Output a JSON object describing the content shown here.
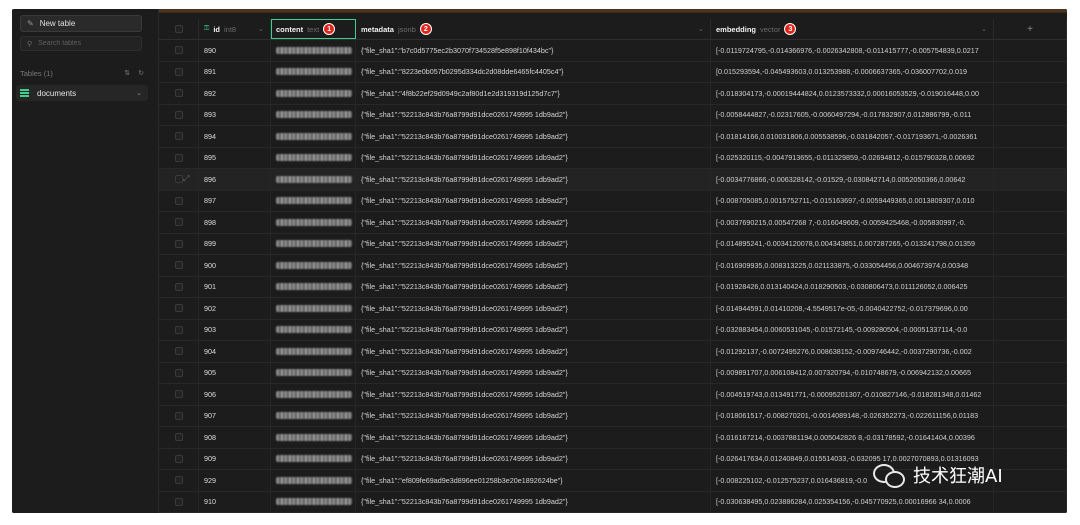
{
  "sidebar": {
    "new_table_label": "New table",
    "search_placeholder": "Search tables",
    "tables_heading": "Tables (1)",
    "tables": [
      {
        "name": "documents"
      }
    ]
  },
  "columns": {
    "id": {
      "name": "id",
      "type": "int8"
    },
    "content": {
      "name": "content",
      "type": "text",
      "badge": "1"
    },
    "metadata": {
      "name": "metadata",
      "type": "jsonb",
      "badge": "2"
    },
    "embedding": {
      "name": "embedding",
      "type": "vector",
      "badge": "3"
    }
  },
  "rows": [
    {
      "id": "890",
      "metadata": "{\"file_sha1\":\"b7c0d5775ec2b3070f734528f5e898f10f434bc\"}",
      "embedding": "[-0.0119724795,-0.014366976,-0.0026342808,-0.011415777,-0.005754839,0.0217"
    },
    {
      "id": "891",
      "metadata": "{\"file_sha1\":\"8223e0b057b0295d334dc2d08dde6465fc4405c4\"}",
      "embedding": "[0.015293594,-0.045493603,0.013253988,-0.0006637365,-0.036007702,0.019"
    },
    {
      "id": "892",
      "metadata": "{\"file_sha1\":\"4f8b22ef29d0949c2af80d1e2d319319d125d7c7\"}",
      "embedding": "[-0.018304173,-0.00019444824,0.0123573332,0.00016053529,-0.019016448,0.00"
    },
    {
      "id": "893",
      "metadata": "{\"file_sha1\":\"52213c843b76a8799d91dce0261749995 1db9ad2\"}",
      "embedding": "[-0.0058444827,-0.02317605,-0.0060497294,-0.017832907,0.012886799,-0.011"
    },
    {
      "id": "894",
      "metadata": "{\"file_sha1\":\"52213c843b76a8799d91dce0261749995 1db9ad2\"}",
      "embedding": "[-0.01814166,0.010031806,0.005538596,-0.031842057,-0.017193671,-0.0026361"
    },
    {
      "id": "895",
      "metadata": "{\"file_sha1\":\"52213c843b76a8799d91dce0261749995 1db9ad2\"}",
      "embedding": "[-0.025320115,-0.0047913655,-0.011329859,-0.02694812,-0.015790328,0.00692"
    },
    {
      "id": "896",
      "metadata": "{\"file_sha1\":\"52213c843b76a8799d91dce0261749995 1db9ad2\"}",
      "embedding": "[-0.0034776866,-0.006328142,-0.01529,-0.030842714,0.0052050366,0.00642"
    },
    {
      "id": "897",
      "metadata": "{\"file_sha1\":\"52213c843b76a8799d91dce0261749995 1db9ad2\"}",
      "embedding": "[-0.008705085,0.0015752711,-0.015163697,-0.0059449365,0.0013809307,0.010"
    },
    {
      "id": "898",
      "metadata": "{\"file_sha1\":\"52213c843b76a8799d91dce0261749995 1db9ad2\"}",
      "embedding": "[-0.0037690215,0.00547268 7,-0.016049609,-0.0059425468,-0.005830997,-0."
    },
    {
      "id": "899",
      "metadata": "{\"file_sha1\":\"52213c843b76a8799d91dce0261749995 1db9ad2\"}",
      "embedding": "[-0.014895241,-0.0034120078,0.004343851,0.007287265,-0.013241798,0.01359"
    },
    {
      "id": "900",
      "metadata": "{\"file_sha1\":\"52213c843b76a8799d91dce0261749995 1db9ad2\"}",
      "embedding": "[-0.016909935,0.008313225,0.021133875,-0.033054456,0.004673974,0.00348"
    },
    {
      "id": "901",
      "metadata": "{\"file_sha1\":\"52213c843b76a8799d91dce0261749995 1db9ad2\"}",
      "embedding": "[-0.01928426,0.013140424,0.018290503,-0.030806473,0.011126052,0.006425"
    },
    {
      "id": "902",
      "metadata": "{\"file_sha1\":\"52213c843b76a8799d91dce0261749995 1db9ad2\"}",
      "embedding": "[-0.014944591,0.01410208,-4.5549517e-05,-0.0040422752,-0.017379696,0.00"
    },
    {
      "id": "903",
      "metadata": "{\"file_sha1\":\"52213c843b76a8799d91dce0261749995 1db9ad2\"}",
      "embedding": "[-0.032883454,0.0060531045,-0.01572145,-0.009280504,-0.00051337114,-0.0"
    },
    {
      "id": "904",
      "metadata": "{\"file_sha1\":\"52213c843b76a8799d91dce0261749995 1db9ad2\"}",
      "embedding": "[-0.01292137,-0.0072495276,0.008638152,-0.009746442,-0.0037290736,-0.002"
    },
    {
      "id": "905",
      "metadata": "{\"file_sha1\":\"52213c843b76a8799d91dce0261749995 1db9ad2\"}",
      "embedding": "[-0.009891707,0.006108412,0.007320794,-0.010748679,-0.006942132,0.00665"
    },
    {
      "id": "906",
      "metadata": "{\"file_sha1\":\"52213c843b76a8799d91dce0261749995 1db9ad2\"}",
      "embedding": "[-0.004519743,0.013491771,-0.00095201307,-0.010827146,-0.018281348,0.01462"
    },
    {
      "id": "907",
      "metadata": "{\"file_sha1\":\"52213c843b76a8799d91dce0261749995 1db9ad2\"}",
      "embedding": "[-0.018061517,-0.008270201,-0.0014089148,-0.026352273,-0.022611156,0.01183"
    },
    {
      "id": "908",
      "metadata": "{\"file_sha1\":\"52213c843b76a8799d91dce0261749995 1db9ad2\"}",
      "embedding": "[-0.016167214,-0.0037881194,0.005042826 8,-0.03178592,-0.01641404,0.00396"
    },
    {
      "id": "909",
      "metadata": "{\"file_sha1\":\"52213c843b76a8799d91dce0261749995 1db9ad2\"}",
      "embedding": "[-0.026417634,0.01240849,0.015514033,-0.032095 17,0.0027070893,0.01316093"
    },
    {
      "id": "929",
      "metadata": "{\"file_sha1\":\"ef809fe69ad9e3d896ee01258b3e20e1892624be\"}",
      "embedding": "[-0.008225102,-0.012575237,0.016436819,-0.0"
    },
    {
      "id": "910",
      "metadata": "{\"file_sha1\":\"52213c843b76a8799d91dce0261749995 1db9ad2\"}",
      "embedding": "[-0.030638495,0.023886284,0.025354156,-0.045770925,0.00016966 34,0.0006"
    }
  ],
  "watermark": {
    "text": "技术狂潮AI"
  },
  "colors": {
    "accent": "#3ecf8e",
    "badge": "#e1261c",
    "background": "#1c1c1c"
  },
  "icons": {
    "new_table": "new-table-icon",
    "search": "search-icon",
    "key": "key-icon",
    "add_column": "plus-icon",
    "table": "table-icon"
  }
}
